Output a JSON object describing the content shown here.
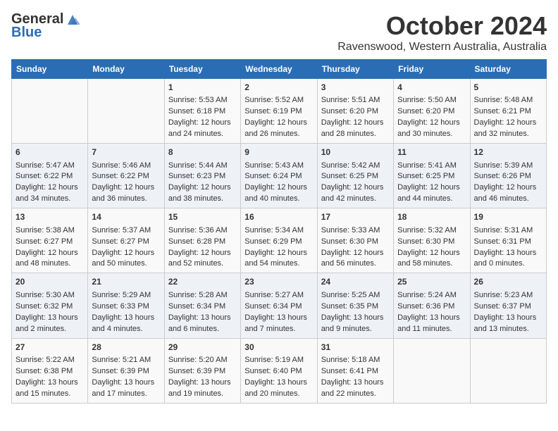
{
  "header": {
    "logo_general": "General",
    "logo_blue": "Blue",
    "month_title": "October 2024",
    "location": "Ravenswood, Western Australia, Australia"
  },
  "days_of_week": [
    "Sunday",
    "Monday",
    "Tuesday",
    "Wednesday",
    "Thursday",
    "Friday",
    "Saturday"
  ],
  "weeks": [
    [
      {
        "day": "",
        "sunrise": "",
        "sunset": "",
        "daylight": ""
      },
      {
        "day": "",
        "sunrise": "",
        "sunset": "",
        "daylight": ""
      },
      {
        "day": "1",
        "sunrise": "Sunrise: 5:53 AM",
        "sunset": "Sunset: 6:18 PM",
        "daylight": "Daylight: 12 hours and 24 minutes."
      },
      {
        "day": "2",
        "sunrise": "Sunrise: 5:52 AM",
        "sunset": "Sunset: 6:19 PM",
        "daylight": "Daylight: 12 hours and 26 minutes."
      },
      {
        "day": "3",
        "sunrise": "Sunrise: 5:51 AM",
        "sunset": "Sunset: 6:20 PM",
        "daylight": "Daylight: 12 hours and 28 minutes."
      },
      {
        "day": "4",
        "sunrise": "Sunrise: 5:50 AM",
        "sunset": "Sunset: 6:20 PM",
        "daylight": "Daylight: 12 hours and 30 minutes."
      },
      {
        "day": "5",
        "sunrise": "Sunrise: 5:48 AM",
        "sunset": "Sunset: 6:21 PM",
        "daylight": "Daylight: 12 hours and 32 minutes."
      }
    ],
    [
      {
        "day": "6",
        "sunrise": "Sunrise: 5:47 AM",
        "sunset": "Sunset: 6:22 PM",
        "daylight": "Daylight: 12 hours and 34 minutes."
      },
      {
        "day": "7",
        "sunrise": "Sunrise: 5:46 AM",
        "sunset": "Sunset: 6:22 PM",
        "daylight": "Daylight: 12 hours and 36 minutes."
      },
      {
        "day": "8",
        "sunrise": "Sunrise: 5:44 AM",
        "sunset": "Sunset: 6:23 PM",
        "daylight": "Daylight: 12 hours and 38 minutes."
      },
      {
        "day": "9",
        "sunrise": "Sunrise: 5:43 AM",
        "sunset": "Sunset: 6:24 PM",
        "daylight": "Daylight: 12 hours and 40 minutes."
      },
      {
        "day": "10",
        "sunrise": "Sunrise: 5:42 AM",
        "sunset": "Sunset: 6:25 PM",
        "daylight": "Daylight: 12 hours and 42 minutes."
      },
      {
        "day": "11",
        "sunrise": "Sunrise: 5:41 AM",
        "sunset": "Sunset: 6:25 PM",
        "daylight": "Daylight: 12 hours and 44 minutes."
      },
      {
        "day": "12",
        "sunrise": "Sunrise: 5:39 AM",
        "sunset": "Sunset: 6:26 PM",
        "daylight": "Daylight: 12 hours and 46 minutes."
      }
    ],
    [
      {
        "day": "13",
        "sunrise": "Sunrise: 5:38 AM",
        "sunset": "Sunset: 6:27 PM",
        "daylight": "Daylight: 12 hours and 48 minutes."
      },
      {
        "day": "14",
        "sunrise": "Sunrise: 5:37 AM",
        "sunset": "Sunset: 6:27 PM",
        "daylight": "Daylight: 12 hours and 50 minutes."
      },
      {
        "day": "15",
        "sunrise": "Sunrise: 5:36 AM",
        "sunset": "Sunset: 6:28 PM",
        "daylight": "Daylight: 12 hours and 52 minutes."
      },
      {
        "day": "16",
        "sunrise": "Sunrise: 5:34 AM",
        "sunset": "Sunset: 6:29 PM",
        "daylight": "Daylight: 12 hours and 54 minutes."
      },
      {
        "day": "17",
        "sunrise": "Sunrise: 5:33 AM",
        "sunset": "Sunset: 6:30 PM",
        "daylight": "Daylight: 12 hours and 56 minutes."
      },
      {
        "day": "18",
        "sunrise": "Sunrise: 5:32 AM",
        "sunset": "Sunset: 6:30 PM",
        "daylight": "Daylight: 12 hours and 58 minutes."
      },
      {
        "day": "19",
        "sunrise": "Sunrise: 5:31 AM",
        "sunset": "Sunset: 6:31 PM",
        "daylight": "Daylight: 13 hours and 0 minutes."
      }
    ],
    [
      {
        "day": "20",
        "sunrise": "Sunrise: 5:30 AM",
        "sunset": "Sunset: 6:32 PM",
        "daylight": "Daylight: 13 hours and 2 minutes."
      },
      {
        "day": "21",
        "sunrise": "Sunrise: 5:29 AM",
        "sunset": "Sunset: 6:33 PM",
        "daylight": "Daylight: 13 hours and 4 minutes."
      },
      {
        "day": "22",
        "sunrise": "Sunrise: 5:28 AM",
        "sunset": "Sunset: 6:34 PM",
        "daylight": "Daylight: 13 hours and 6 minutes."
      },
      {
        "day": "23",
        "sunrise": "Sunrise: 5:27 AM",
        "sunset": "Sunset: 6:34 PM",
        "daylight": "Daylight: 13 hours and 7 minutes."
      },
      {
        "day": "24",
        "sunrise": "Sunrise: 5:25 AM",
        "sunset": "Sunset: 6:35 PM",
        "daylight": "Daylight: 13 hours and 9 minutes."
      },
      {
        "day": "25",
        "sunrise": "Sunrise: 5:24 AM",
        "sunset": "Sunset: 6:36 PM",
        "daylight": "Daylight: 13 hours and 11 minutes."
      },
      {
        "day": "26",
        "sunrise": "Sunrise: 5:23 AM",
        "sunset": "Sunset: 6:37 PM",
        "daylight": "Daylight: 13 hours and 13 minutes."
      }
    ],
    [
      {
        "day": "27",
        "sunrise": "Sunrise: 5:22 AM",
        "sunset": "Sunset: 6:38 PM",
        "daylight": "Daylight: 13 hours and 15 minutes."
      },
      {
        "day": "28",
        "sunrise": "Sunrise: 5:21 AM",
        "sunset": "Sunset: 6:39 PM",
        "daylight": "Daylight: 13 hours and 17 minutes."
      },
      {
        "day": "29",
        "sunrise": "Sunrise: 5:20 AM",
        "sunset": "Sunset: 6:39 PM",
        "daylight": "Daylight: 13 hours and 19 minutes."
      },
      {
        "day": "30",
        "sunrise": "Sunrise: 5:19 AM",
        "sunset": "Sunset: 6:40 PM",
        "daylight": "Daylight: 13 hours and 20 minutes."
      },
      {
        "day": "31",
        "sunrise": "Sunrise: 5:18 AM",
        "sunset": "Sunset: 6:41 PM",
        "daylight": "Daylight: 13 hours and 22 minutes."
      },
      {
        "day": "",
        "sunrise": "",
        "sunset": "",
        "daylight": ""
      },
      {
        "day": "",
        "sunrise": "",
        "sunset": "",
        "daylight": ""
      }
    ]
  ]
}
